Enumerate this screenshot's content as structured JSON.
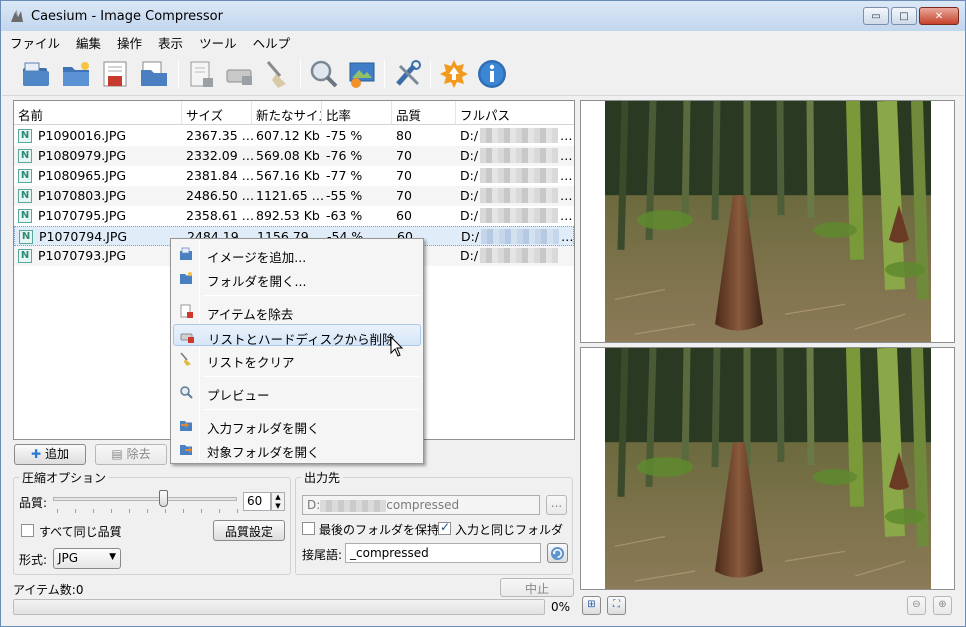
{
  "window": {
    "title": "Caesium - Image Compressor",
    "buttons": {
      "minimize": "▭",
      "maximize": "□",
      "close": "✕"
    }
  },
  "menubar": [
    "ファイル",
    "編集",
    "操作",
    "表示",
    "ツール",
    "ヘルプ"
  ],
  "toolbar": {
    "icons": [
      "open-files-icon",
      "open-folder-icon",
      "save-list-icon",
      "open-list-icon",
      "remove-item-icon",
      "delete-from-disk-icon",
      "clear-list-icon",
      "preview-icon",
      "compress-icon",
      "settings-icon",
      "update-icon",
      "about-icon"
    ]
  },
  "file_list": {
    "columns": [
      "名前",
      "サイズ",
      "新たなサイズ",
      "比率",
      "品質",
      "フルパス"
    ],
    "rows": [
      {
        "name": "P1090016.JPG",
        "size": "2367.35 …",
        "new_size": "607.12 Kb",
        "ratio": "-75 %",
        "quality": "80",
        "path": "D:/"
      },
      {
        "name": "P1080979.JPG",
        "size": "2332.09 …",
        "new_size": "569.08 Kb",
        "ratio": "-76 %",
        "quality": "70",
        "path": "D:/"
      },
      {
        "name": "P1080965.JPG",
        "size": "2381.84 …",
        "new_size": "567.16 Kb",
        "ratio": "-77 %",
        "quality": "70",
        "path": "D:/"
      },
      {
        "name": "P1070803.JPG",
        "size": "2486.50 …",
        "new_size": "1121.65 …",
        "ratio": "-55 %",
        "quality": "70",
        "path": "D:/"
      },
      {
        "name": "P1070795.JPG",
        "size": "2358.61 …",
        "new_size": "892.53 Kb",
        "ratio": "-63 %",
        "quality": "60",
        "path": "D:/"
      },
      {
        "name": "P1070794.JPG",
        "size": "2484.19 …",
        "new_size": "1156.79 …",
        "ratio": "-54 %",
        "quality": "60",
        "path": "D:/"
      },
      {
        "name": "P1070793.JPG",
        "size": "",
        "new_size": "",
        "ratio": "",
        "quality": "",
        "path": "D:/"
      }
    ],
    "overflow_mark": "…"
  },
  "list_buttons": {
    "add": "追加",
    "remove": "除去"
  },
  "context_menu": {
    "items": [
      {
        "label": "イメージを追加...",
        "icon": "add-image-icon"
      },
      {
        "label": "フォルダを開く...",
        "icon": "open-folder-icon"
      },
      {
        "label": "アイテムを除去",
        "icon": "remove-item-icon"
      },
      {
        "label": "リストとハードディスクから削除",
        "icon": "delete-from-disk-icon"
      },
      {
        "label": "リストをクリア",
        "icon": "broom-icon"
      },
      {
        "label": "プレビュー",
        "icon": "magnifier-icon"
      },
      {
        "label": "入力フォルダを開く",
        "icon": "input-folder-icon"
      },
      {
        "label": "対象フォルダを開く",
        "icon": "output-folder-icon"
      }
    ],
    "hovered_index": 3
  },
  "compression": {
    "title": "圧縮オプション",
    "quality_label": "品質:",
    "quality_value": "60",
    "quality_fraction": 0.6,
    "same_quality_label": "すべて同じ品質",
    "same_quality_checked": false,
    "quality_settings_button": "品質設定",
    "format_label": "形式:",
    "format_value": "JPG"
  },
  "output": {
    "title": "出力先",
    "path_value": "D:",
    "path_suffix": "compressed",
    "browse_label": "...",
    "keep_last_folder_label": "最後のフォルダを保持",
    "keep_last_folder_checked": false,
    "same_as_input_label": "入力と同じフォルダ",
    "same_as_input_checked": true,
    "suffix_label": "接尾語:",
    "suffix_value": "_compressed"
  },
  "status": {
    "item_count": "アイテム数:0",
    "stop_button": "中止",
    "progress_percent": "0%",
    "progress_fraction": 0
  },
  "colors": {
    "selection": "#e0ecf8",
    "hover": "#d6e6f8",
    "title_gradient_top": "#dbe8f6"
  }
}
